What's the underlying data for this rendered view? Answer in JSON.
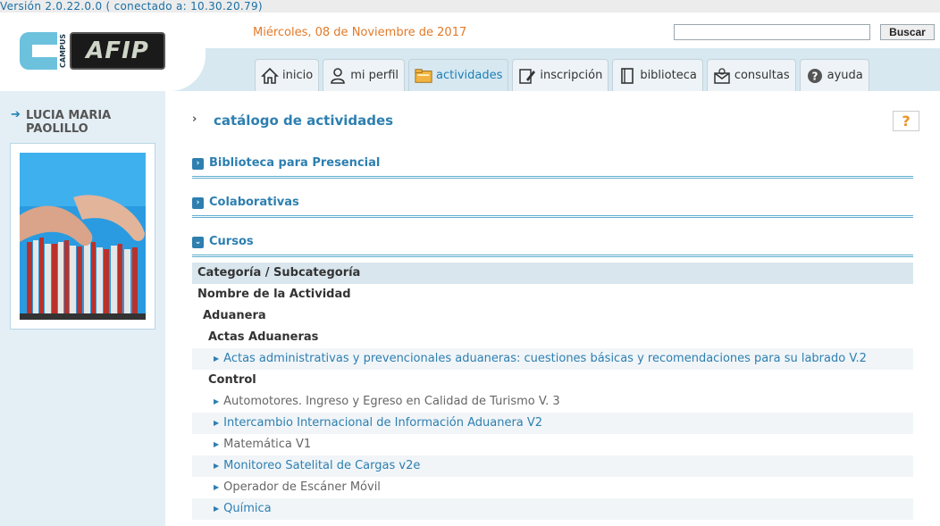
{
  "version": "Versión 2.0.22.0.0 ( conectado a: 10.30.20.79)",
  "header": {
    "logo_campus": "CAMPUS",
    "logo_text": "AFIP",
    "date": "Miércoles, 08 de Noviembre de 2017",
    "search": {
      "value": "",
      "placeholder": "",
      "button": "Buscar"
    },
    "tabs": [
      {
        "label": "inicio",
        "icon": "home-icon",
        "active": false
      },
      {
        "label": "mi perfil",
        "icon": "user-icon",
        "active": false
      },
      {
        "label": "actividades",
        "icon": "folder-icon",
        "active": true
      },
      {
        "label": "inscripción",
        "icon": "edit-icon",
        "active": false
      },
      {
        "label": "biblioteca",
        "icon": "book-icon",
        "active": false
      },
      {
        "label": "consultas",
        "icon": "mail-icon",
        "active": false
      },
      {
        "label": "ayuda",
        "icon": "help-icon",
        "active": false
      }
    ]
  },
  "sidebar": {
    "user_name": "LUCIA MARIA PAOLILLO"
  },
  "main": {
    "breadcrumb_arrow": "›",
    "title": "catálogo de actividades",
    "help_label": "?",
    "sections": [
      {
        "label": "Biblioteca para Presencial",
        "expanded": false
      },
      {
        "label": "Colaborativas",
        "expanded": false
      },
      {
        "label": "Cursos",
        "expanded": true
      }
    ],
    "table": {
      "header": "Categoría / Subcategoría",
      "subheader": "Nombre de la Actividad",
      "category": "Aduanera",
      "subcategories": [
        {
          "name": "Actas Aduaneras",
          "items": [
            {
              "label": "Actas administrativas y prevencionales aduaneras: cuestiones básicas y recomendaciones para su labrado V.2",
              "link": true
            }
          ]
        },
        {
          "name": "Control",
          "items": [
            {
              "label": "Automotores. Ingreso y Egreso en Calidad de Turismo V. 3",
              "link": false
            },
            {
              "label": "Intercambio Internacional de Información Aduanera V2",
              "link": true
            },
            {
              "label": "Matemática V1",
              "link": false
            },
            {
              "label": "Monitoreo Satelital de Cargas v2e",
              "link": true
            },
            {
              "label": "Operador de Escáner Móvil",
              "link": false
            },
            {
              "label": "Química",
              "link": true
            }
          ]
        }
      ]
    }
  },
  "colors": {
    "accent": "#2d7fb0",
    "date": "#e27a28",
    "sidebar_bg": "#e4eff5"
  }
}
